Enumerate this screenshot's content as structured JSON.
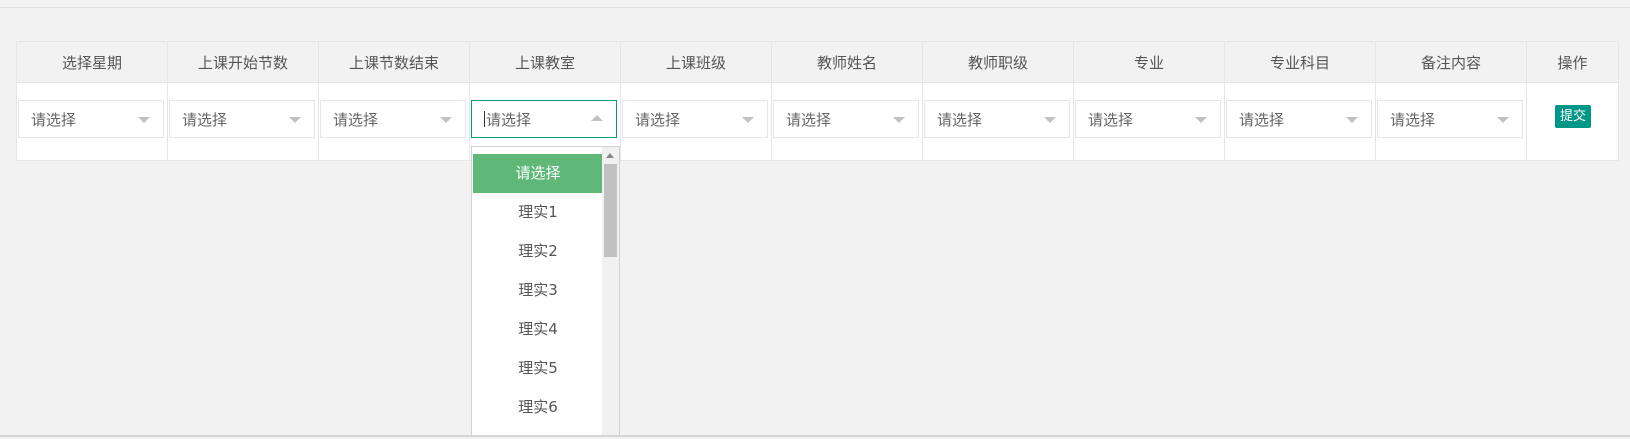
{
  "headers": [
    "选择星期",
    "上课开始节数",
    "上课节数结束",
    "上课教室",
    "上课班级",
    "教师姓名",
    "教师职级",
    "专业",
    "专业科目",
    "备注内容",
    "操作"
  ],
  "selects": [
    {
      "value": "请选择"
    },
    {
      "value": "请选择"
    },
    {
      "value": "请选择"
    },
    {
      "value": "请选择"
    },
    {
      "value": "请选择"
    },
    {
      "value": "请选择"
    },
    {
      "value": "请选择"
    },
    {
      "value": "请选择"
    },
    {
      "value": "请选择"
    },
    {
      "value": "请选择"
    }
  ],
  "submit_label": "提交",
  "dropdown": {
    "options": [
      "请选择",
      "理实1",
      "理实2",
      "理实3",
      "理实4",
      "理实5",
      "理实6"
    ],
    "selected_index": 0
  },
  "colors": {
    "accent": "#009688",
    "option_active": "#5fb878"
  }
}
